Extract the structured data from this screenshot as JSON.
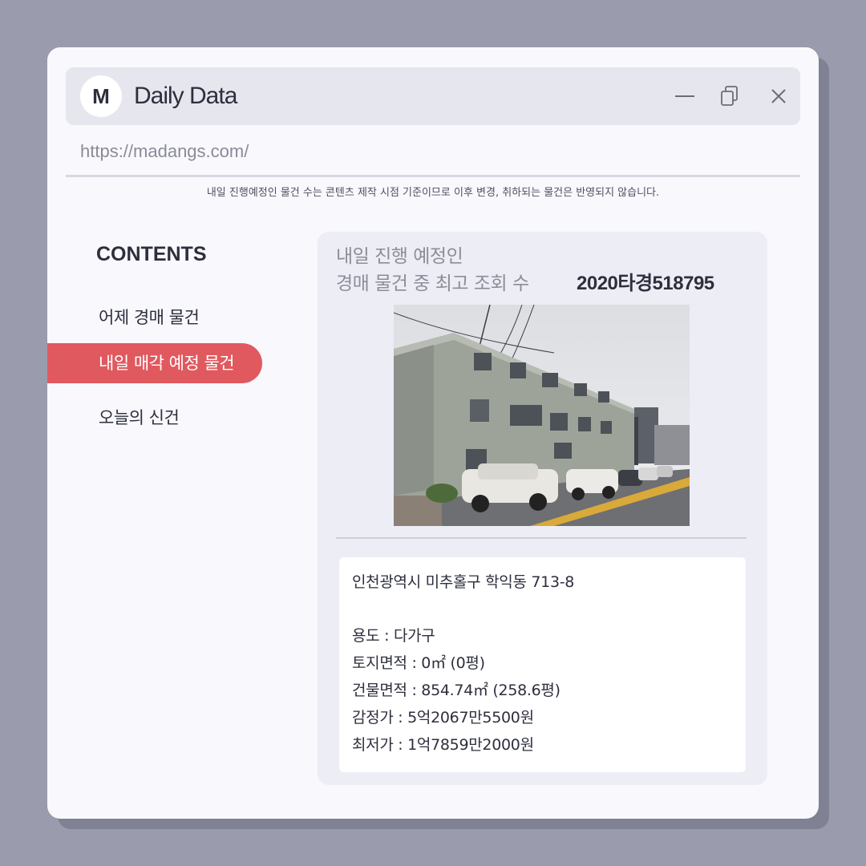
{
  "app": {
    "logo_letter": "M",
    "title": "Daily Data",
    "url": "https://madangs.com/"
  },
  "window_controls": {
    "minimize_icon": "minimize-icon",
    "restore_icon": "restore-icon",
    "close_icon": "close-icon"
  },
  "notice": "내일 진행예정인 물건 수는 콘텐츠 제작 시점 기준이므로 이후 변경, 취하되는 물건은 반영되지 않습니다.",
  "sidebar": {
    "heading": "CONTENTS",
    "items": [
      {
        "label": "어제 경매 물건",
        "active": false
      },
      {
        "label": "내일 매각 예정 물건",
        "active": true
      },
      {
        "label": "오늘의 신건",
        "active": false
      }
    ]
  },
  "card": {
    "title_line1": "내일 진행 예정인",
    "title_line2": "경매 물건 중 최고 조회 수",
    "case_number": "2020타경518795",
    "address": "인천광역시 미추홀구 학익동 713-8",
    "details": [
      "용도 : 다가구",
      "토지면적 : 0㎡ (0평)",
      "건물면적 : 854.74㎡ (258.6평)",
      "감정가 : 5억2067만5500원",
      "최저가 : 1억7859만2000원"
    ]
  },
  "colors": {
    "background": "#9a9bad",
    "window": "#f8f8fd",
    "titlebar": "#e6e6ee",
    "accent": "#e0595f",
    "card": "#ededf6",
    "text": "#2d2f3d",
    "muted": "#8c8d98"
  }
}
